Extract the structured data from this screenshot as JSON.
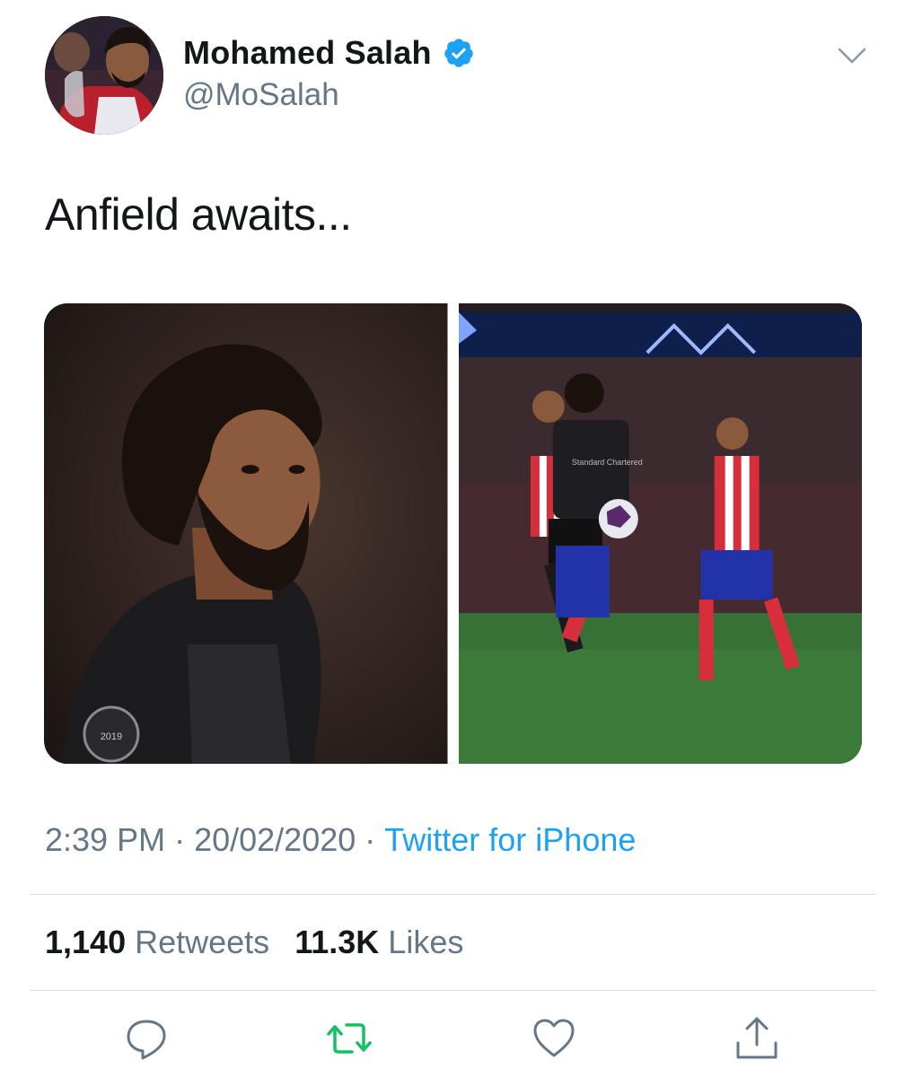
{
  "tweet": {
    "author": {
      "name": "Mohamed Salah",
      "handle": "@MoSalah",
      "verified": true
    },
    "text": "Anfield awaits...",
    "media": [
      {
        "alt": "Mohamed Salah portrait",
        "badge_text": "2019"
      },
      {
        "alt": "Mohamed Salah controlling the ball",
        "sponsor_text": "Standard Chartered"
      }
    ],
    "timestamp": {
      "time": "2:39 PM",
      "separator": "·",
      "date": "20/02/2020",
      "source": "Twitter for iPhone"
    },
    "stats": {
      "retweets_count": "1,140",
      "retweets_label": "Retweets",
      "likes_count": "11.3K",
      "likes_label": "Likes"
    },
    "actions": [
      {
        "icon": "reply-icon"
      },
      {
        "icon": "retweet-icon"
      },
      {
        "icon": "like-icon"
      },
      {
        "icon": "share-icon"
      }
    ]
  },
  "colors": {
    "text": "#14171a",
    "secondary": "#657786",
    "link": "#1da1f2",
    "retweet": "#17bf63",
    "divider": "#dcdfe2"
  }
}
